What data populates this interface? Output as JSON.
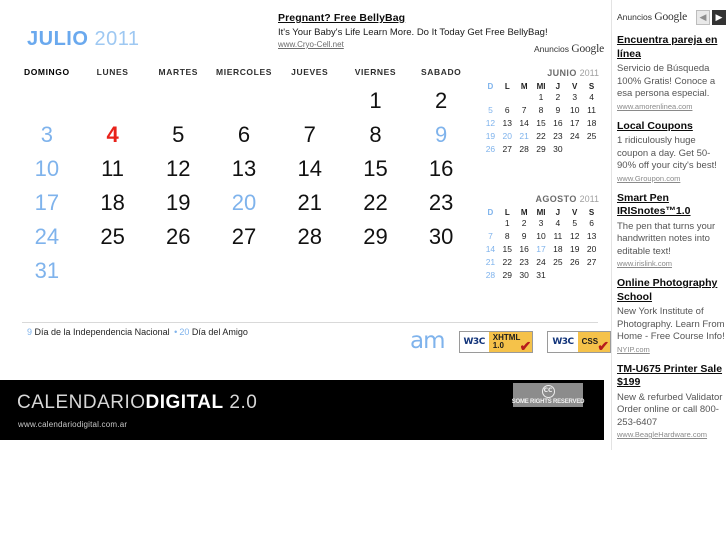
{
  "top_ad": {
    "title": "Pregnant? Free BellyBag",
    "desc": "It's Your Baby's Life Learn More. Do It Today Get Free BellyBag!",
    "url": "www.Cryo-Cell.net",
    "gads_prefix": "Anuncios ",
    "gads_word": "Google"
  },
  "month": {
    "name": "JULIO",
    "year": "2011",
    "weekdays": [
      "DOMINGO",
      "LUNES",
      "MARTES",
      "MIERCOLES",
      "JUEVES",
      "VIERNES",
      "SABADO"
    ],
    "weeks": [
      [
        {
          "d": "",
          "k": "empty"
        },
        {
          "d": "",
          "k": "empty"
        },
        {
          "d": "",
          "k": "empty"
        },
        {
          "d": "",
          "k": "empty"
        },
        {
          "d": "",
          "k": "empty"
        },
        {
          "d": "1",
          "k": ""
        },
        {
          "d": "2",
          "k": ""
        }
      ],
      [
        {
          "d": "3",
          "k": "sunday"
        },
        {
          "d": "4",
          "k": "today"
        },
        {
          "d": "5",
          "k": ""
        },
        {
          "d": "6",
          "k": ""
        },
        {
          "d": "7",
          "k": ""
        },
        {
          "d": "8",
          "k": ""
        },
        {
          "d": "9",
          "k": "holiday"
        }
      ],
      [
        {
          "d": "10",
          "k": "sunday"
        },
        {
          "d": "11",
          "k": ""
        },
        {
          "d": "12",
          "k": ""
        },
        {
          "d": "13",
          "k": ""
        },
        {
          "d": "14",
          "k": ""
        },
        {
          "d": "15",
          "k": ""
        },
        {
          "d": "16",
          "k": ""
        }
      ],
      [
        {
          "d": "17",
          "k": "sunday"
        },
        {
          "d": "18",
          "k": ""
        },
        {
          "d": "19",
          "k": ""
        },
        {
          "d": "20",
          "k": "holiday"
        },
        {
          "d": "21",
          "k": ""
        },
        {
          "d": "22",
          "k": ""
        },
        {
          "d": "23",
          "k": ""
        }
      ],
      [
        {
          "d": "24",
          "k": "sunday"
        },
        {
          "d": "25",
          "k": ""
        },
        {
          "d": "26",
          "k": ""
        },
        {
          "d": "27",
          "k": ""
        },
        {
          "d": "28",
          "k": ""
        },
        {
          "d": "29",
          "k": ""
        },
        {
          "d": "30",
          "k": ""
        }
      ],
      [
        {
          "d": "31",
          "k": "sunday"
        },
        {
          "d": "",
          "k": "empty"
        },
        {
          "d": "",
          "k": "empty"
        },
        {
          "d": "",
          "k": "empty"
        },
        {
          "d": "",
          "k": "empty"
        },
        {
          "d": "",
          "k": "empty"
        },
        {
          "d": "",
          "k": "empty"
        }
      ]
    ]
  },
  "legend": {
    "items": [
      {
        "num": "9",
        "text": "Día de la Independencia Nacional"
      },
      {
        "num": "20",
        "text": "Día del Amigo"
      }
    ],
    "separator": "•"
  },
  "mini_calendars": [
    {
      "name": "JUNIO",
      "year": "2011",
      "headers": [
        "D",
        "L",
        "M",
        "MI",
        "J",
        "V",
        "S"
      ],
      "weeks": [
        [
          {
            "d": "",
            "k": "empty"
          },
          {
            "d": "",
            "k": "empty"
          },
          {
            "d": "",
            "k": "empty"
          },
          {
            "d": "1",
            "k": ""
          },
          {
            "d": "2",
            "k": ""
          },
          {
            "d": "3",
            "k": ""
          },
          {
            "d": "4",
            "k": ""
          }
        ],
        [
          {
            "d": "5",
            "k": ""
          },
          {
            "d": "6",
            "k": ""
          },
          {
            "d": "7",
            "k": ""
          },
          {
            "d": "8",
            "k": ""
          },
          {
            "d": "9",
            "k": ""
          },
          {
            "d": "10",
            "k": ""
          },
          {
            "d": "11",
            "k": ""
          }
        ],
        [
          {
            "d": "12",
            "k": ""
          },
          {
            "d": "13",
            "k": ""
          },
          {
            "d": "14",
            "k": ""
          },
          {
            "d": "15",
            "k": ""
          },
          {
            "d": "16",
            "k": ""
          },
          {
            "d": "17",
            "k": ""
          },
          {
            "d": "18",
            "k": ""
          }
        ],
        [
          {
            "d": "19",
            "k": "hl"
          },
          {
            "d": "20",
            "k": "hl"
          },
          {
            "d": "21",
            "k": "hl"
          },
          {
            "d": "22",
            "k": ""
          },
          {
            "d": "23",
            "k": ""
          },
          {
            "d": "24",
            "k": ""
          },
          {
            "d": "25",
            "k": ""
          }
        ],
        [
          {
            "d": "26",
            "k": ""
          },
          {
            "d": "27",
            "k": ""
          },
          {
            "d": "28",
            "k": ""
          },
          {
            "d": "29",
            "k": ""
          },
          {
            "d": "30",
            "k": ""
          },
          {
            "d": "",
            "k": "empty"
          },
          {
            "d": "",
            "k": "empty"
          }
        ]
      ]
    },
    {
      "name": "AGOSTO",
      "year": "2011",
      "headers": [
        "D",
        "L",
        "M",
        "MI",
        "J",
        "V",
        "S"
      ],
      "weeks": [
        [
          {
            "d": "",
            "k": "empty"
          },
          {
            "d": "1",
            "k": ""
          },
          {
            "d": "2",
            "k": ""
          },
          {
            "d": "3",
            "k": ""
          },
          {
            "d": "4",
            "k": ""
          },
          {
            "d": "5",
            "k": ""
          },
          {
            "d": "6",
            "k": ""
          }
        ],
        [
          {
            "d": "7",
            "k": ""
          },
          {
            "d": "8",
            "k": ""
          },
          {
            "d": "9",
            "k": ""
          },
          {
            "d": "10",
            "k": ""
          },
          {
            "d": "11",
            "k": ""
          },
          {
            "d": "12",
            "k": ""
          },
          {
            "d": "13",
            "k": ""
          }
        ],
        [
          {
            "d": "14",
            "k": ""
          },
          {
            "d": "15",
            "k": ""
          },
          {
            "d": "16",
            "k": ""
          },
          {
            "d": "17",
            "k": "hl"
          },
          {
            "d": "18",
            "k": ""
          },
          {
            "d": "19",
            "k": ""
          },
          {
            "d": "20",
            "k": ""
          }
        ],
        [
          {
            "d": "21",
            "k": ""
          },
          {
            "d": "22",
            "k": ""
          },
          {
            "d": "23",
            "k": ""
          },
          {
            "d": "24",
            "k": ""
          },
          {
            "d": "25",
            "k": ""
          },
          {
            "d": "26",
            "k": ""
          },
          {
            "d": "27",
            "k": ""
          }
        ],
        [
          {
            "d": "28",
            "k": ""
          },
          {
            "d": "29",
            "k": ""
          },
          {
            "d": "30",
            "k": ""
          },
          {
            "d": "31",
            "k": ""
          },
          {
            "d": "",
            "k": "empty"
          },
          {
            "d": "",
            "k": "empty"
          },
          {
            "d": "",
            "k": "empty"
          }
        ]
      ]
    }
  ],
  "badges": {
    "am_logo": "am",
    "xhtml": {
      "left": "W3C",
      "line1": "XHTML",
      "line2": "1.0",
      "check": "✔"
    },
    "css": {
      "left": "W3C",
      "line1": "CSS",
      "line2": "",
      "check": "✔"
    }
  },
  "footer": {
    "brand_light": "CALENDARIO",
    "brand_bold": "DIGITAL",
    "brand_version": " 2.0",
    "url": "www.calendariodigital.com.ar",
    "cc_symbol": "CC",
    "cc_text": "SOME RIGHTS RESERVED"
  },
  "right_column": {
    "gads_prefix": "Anuncios ",
    "gads_word": "Google",
    "prev_arrow": "◀",
    "next_arrow": "▶",
    "ads": [
      {
        "title": "Encuentra pareja en línea",
        "desc": "Servicio de Búsqueda 100% Gratis! Conoce a esa persona especial.",
        "url": "www.amorenlinea.com"
      },
      {
        "title": "Local Coupons",
        "desc": "1 ridiculously huge coupon a day. Get 50-90% off your city's best!",
        "url": "www.Groupon.com"
      },
      {
        "title": "Smart Pen IRISnotes™1.0",
        "desc": "The pen that turns your handwritten notes into editable text!",
        "url": "www.irislink.com"
      },
      {
        "title": "Online Photography School",
        "desc": "New York Institute of Photography. Learn From Home - Free Course Info!",
        "url": "NYIP.com"
      },
      {
        "title": "TM-U675 Printer Sale $199",
        "desc": "New & refurbed Validator Order online or call 800-253-6407",
        "url": "www.BeagleHardware.com"
      }
    ]
  }
}
